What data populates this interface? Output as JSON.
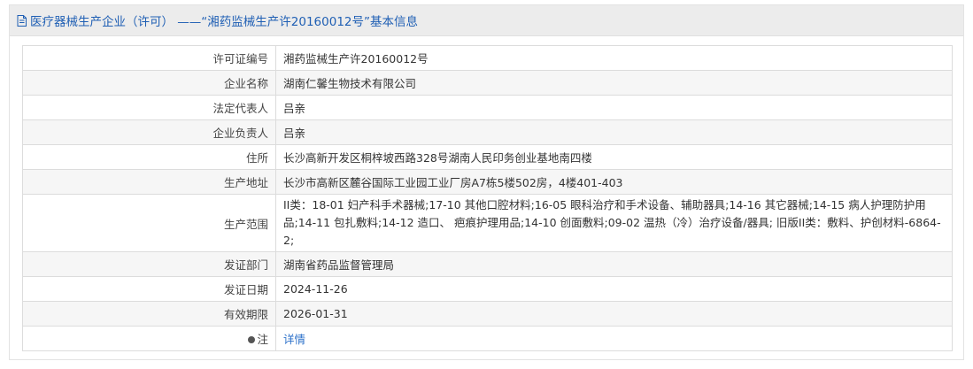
{
  "header": {
    "title": "医疗器械生产企业（许可）  ——“湘药监械生产许20160012号”基本信息"
  },
  "rows": [
    {
      "label": "许可证编号",
      "value": "湘药监械生产许20160012号"
    },
    {
      "label": "企业名称",
      "value": "湖南仁馨生物技术有限公司"
    },
    {
      "label": "法定代表人",
      "value": "吕亲"
    },
    {
      "label": "企业负责人",
      "value": "吕亲"
    },
    {
      "label": "住所",
      "value": "长沙高新开发区桐梓坡西路328号湖南人民印务创业基地南四楼"
    },
    {
      "label": "生产地址",
      "value": "长沙市高新区麓谷国际工业园工业厂房A7栋5楼502房，4楼401-403"
    },
    {
      "label": "生产范围",
      "value": "II类：18-01 妇产科手术器械;17-10 其他口腔材料;16-05 眼科治疗和手术设备、辅助器具;14-16 其它器械;14-15 病人护理防护用品;14-11 包扎敷料;14-12 造口、 疤痕护理用品;14-10 创面敷料;09-02 温热（冷）治疗设备/器具; 旧版II类：敷料、护创材料-6864-2;"
    },
    {
      "label": "发证部门",
      "value": "湖南省药品监督管理局"
    },
    {
      "label": "发证日期",
      "value": "2024-11-26"
    },
    {
      "label": "有效期限",
      "value": "2026-01-31"
    },
    {
      "label": "注",
      "value": "详情",
      "icon": "info-bulb-icon"
    }
  ],
  "colors": {
    "title": "#1f5fb4",
    "link": "#2a6fc9",
    "header_bg": "#ececec",
    "alt_row_bg": "#f6f6f6"
  }
}
